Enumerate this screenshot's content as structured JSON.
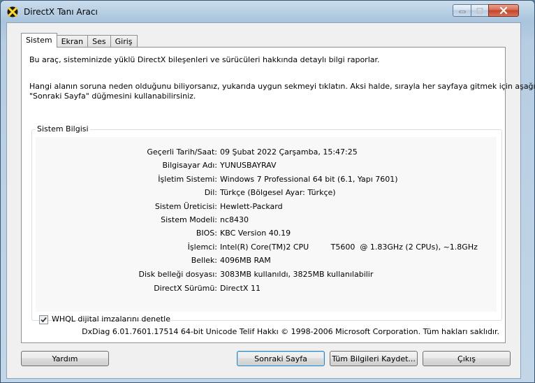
{
  "window": {
    "title": "DirectX Tanı Aracı",
    "icon": "directx-logo-icon"
  },
  "tabs": [
    {
      "label": "Sistem",
      "active": true
    },
    {
      "label": "Ekran",
      "active": false
    },
    {
      "label": "Ses",
      "active": false
    },
    {
      "label": "Giriş",
      "active": false
    }
  ],
  "intro": {
    "line1": "Bu araç, sisteminizde yüklü DirectX bileşenleri ve sürücüleri hakkında detaylı bilgi raporlar.",
    "line2": "Hangi alanın soruna neden olduğunu biliyorsanız, yukarıda uygun sekmeyi tıklatın.  Aksi halde, sırayla her sayfaya gitmek için aşağıdaki",
    "line3": "\"Sonraki Sayfa\" düğmesini kullanabilirsiniz."
  },
  "system_info": {
    "title": "Sistem Bilgisi",
    "rows": [
      {
        "label": "Geçerli Tarih/Saat:",
        "value": "09 Şubat 2022 Çarşamba, 15:47:25"
      },
      {
        "label": "Bilgisayar Adı:",
        "value": "YUNUSBAYRAV"
      },
      {
        "label": "İşletim Sistemi:",
        "value": "Windows 7 Professional 64 bit (6.1, Yapı 7601)"
      },
      {
        "label": "Dil:",
        "value": "Türkçe (Bölgesel Ayar: Türkçe)"
      },
      {
        "label": "Sistem Üreticisi:",
        "value": "Hewlett-Packard"
      },
      {
        "label": "Sistem Modeli:",
        "value": "nc8430"
      },
      {
        "label": "BIOS:",
        "value": "KBC Version 40.19"
      },
      {
        "label": "İşlemci:",
        "value": "Intel(R) Core(TM)2 CPU         T5600  @ 1.83GHz (2 CPUs), ~1.8GHz"
      },
      {
        "label": "Bellek:",
        "value": "4096MB RAM"
      },
      {
        "label": "Disk belleği dosyası:",
        "value": "3083MB kullanıldı, 3825MB kullanılabilir"
      },
      {
        "label": "DirectX Sürümü:",
        "value": "DirectX 11"
      }
    ],
    "whql_label": "WHQL dijital imzalarını denetle",
    "whql_checked": true
  },
  "footer": {
    "copyright": "DxDiag 6.01.7601.17514 64-bit Unicode  Telif Hakkı © 1998-2006 Microsoft Corporation.  Tüm hakları saklıdır."
  },
  "buttons": {
    "help": "Yardım",
    "next": "Sonraki Sayfa",
    "save_all": "Tüm Bilgileri Kaydet...",
    "exit": "Çıkış"
  }
}
